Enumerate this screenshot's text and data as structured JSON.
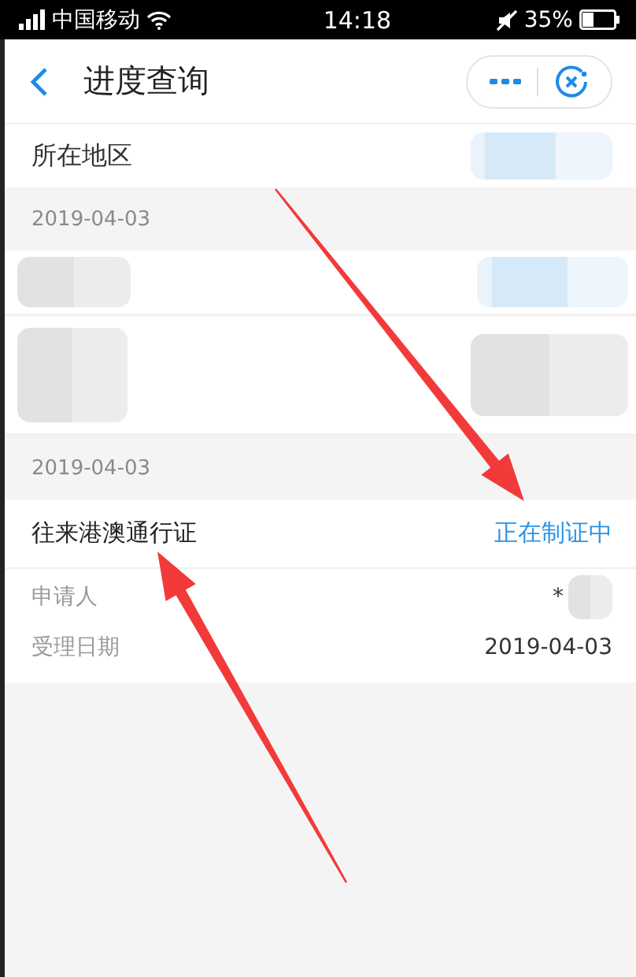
{
  "status_bar": {
    "carrier": "中国移动",
    "time": "14:18",
    "battery": "35%",
    "muted": true
  },
  "header": {
    "title": "进度查询"
  },
  "region_row": {
    "label": "所在地区",
    "value_blurred": true
  },
  "sections": [
    {
      "date": "2019-04-03",
      "items": [
        {
          "kind": "blurred"
        },
        {
          "kind": "blurred_tall"
        }
      ]
    },
    {
      "date": "2019-04-03",
      "items": [
        {
          "kind": "document",
          "title": "往来港澳通行证",
          "status": "正在制证中",
          "details": [
            {
              "label": "申请人",
              "value": "*",
              "blurred": true
            },
            {
              "label": "受理日期",
              "value": "2019-04-03",
              "blurred": false
            }
          ]
        }
      ]
    }
  ],
  "annotations": [
    {
      "kind": "arrow"
    },
    {
      "kind": "arrow"
    }
  ]
}
